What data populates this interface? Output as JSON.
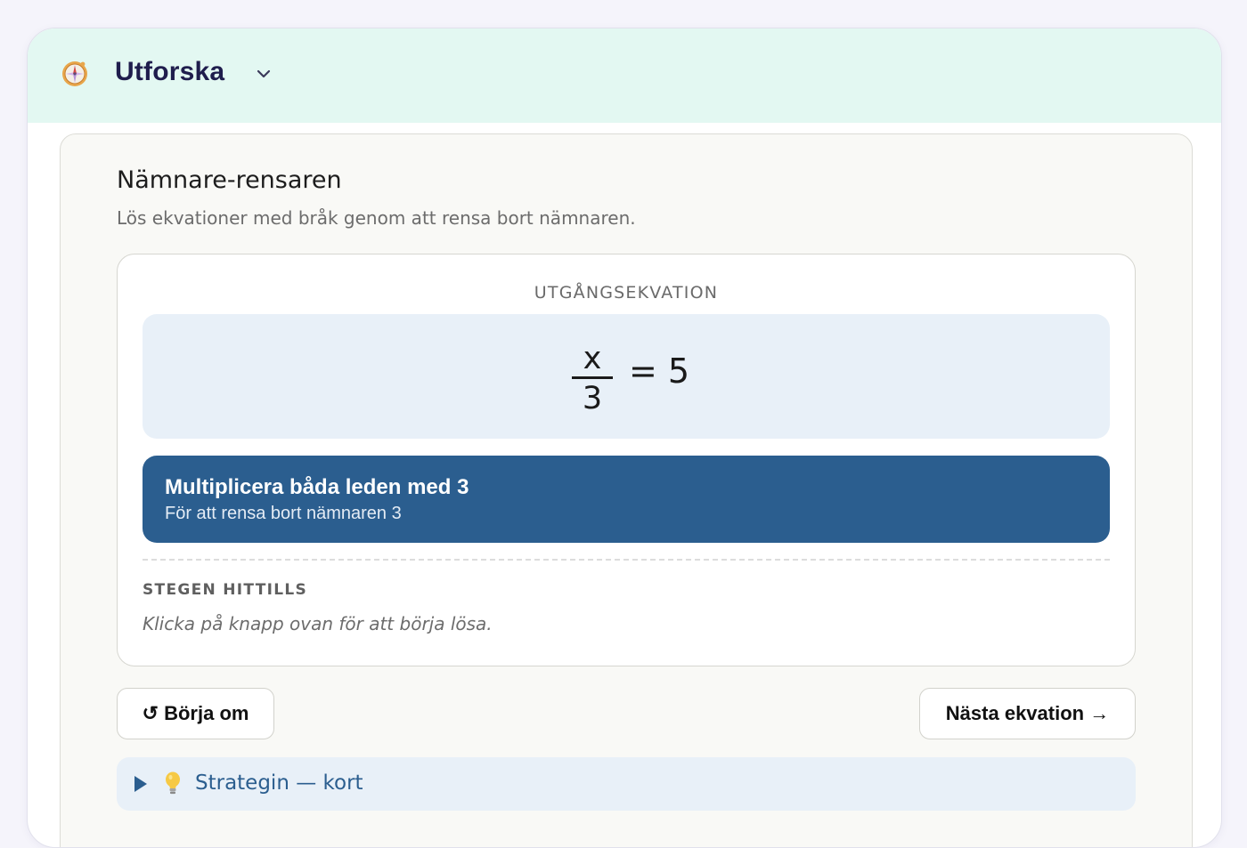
{
  "header": {
    "title": "Utforska",
    "icon": "compass-icon",
    "dropdown_icon": "chevron-down-icon"
  },
  "panel": {
    "title": "Nämnare-rensaren",
    "subtitle": "Lös ekvationer med bråk genom att rensa bort nämnaren."
  },
  "equation": {
    "label": "UTGÅNGSEKVATION",
    "numerator": "x",
    "denominator": "3",
    "rhs": "= 5"
  },
  "step_action": {
    "title": "Multiplicera båda leden med 3",
    "subtitle": "För att rensa bort nämnaren 3"
  },
  "steps": {
    "title": "STEGEN HITTILLS",
    "empty_text": "Klicka på knapp ovan för att börja lösa."
  },
  "buttons": {
    "restart": "↺ Börja om",
    "next": "Nästa ekvation →"
  },
  "strategy": {
    "label": "Strategin — kort",
    "icon": "lightbulb-icon"
  },
  "colors": {
    "header_bg": "#e3f8f2",
    "accent": "#2b5e8f",
    "equation_bg": "#e8f0f8",
    "title_dark": "#1f1d4d"
  }
}
